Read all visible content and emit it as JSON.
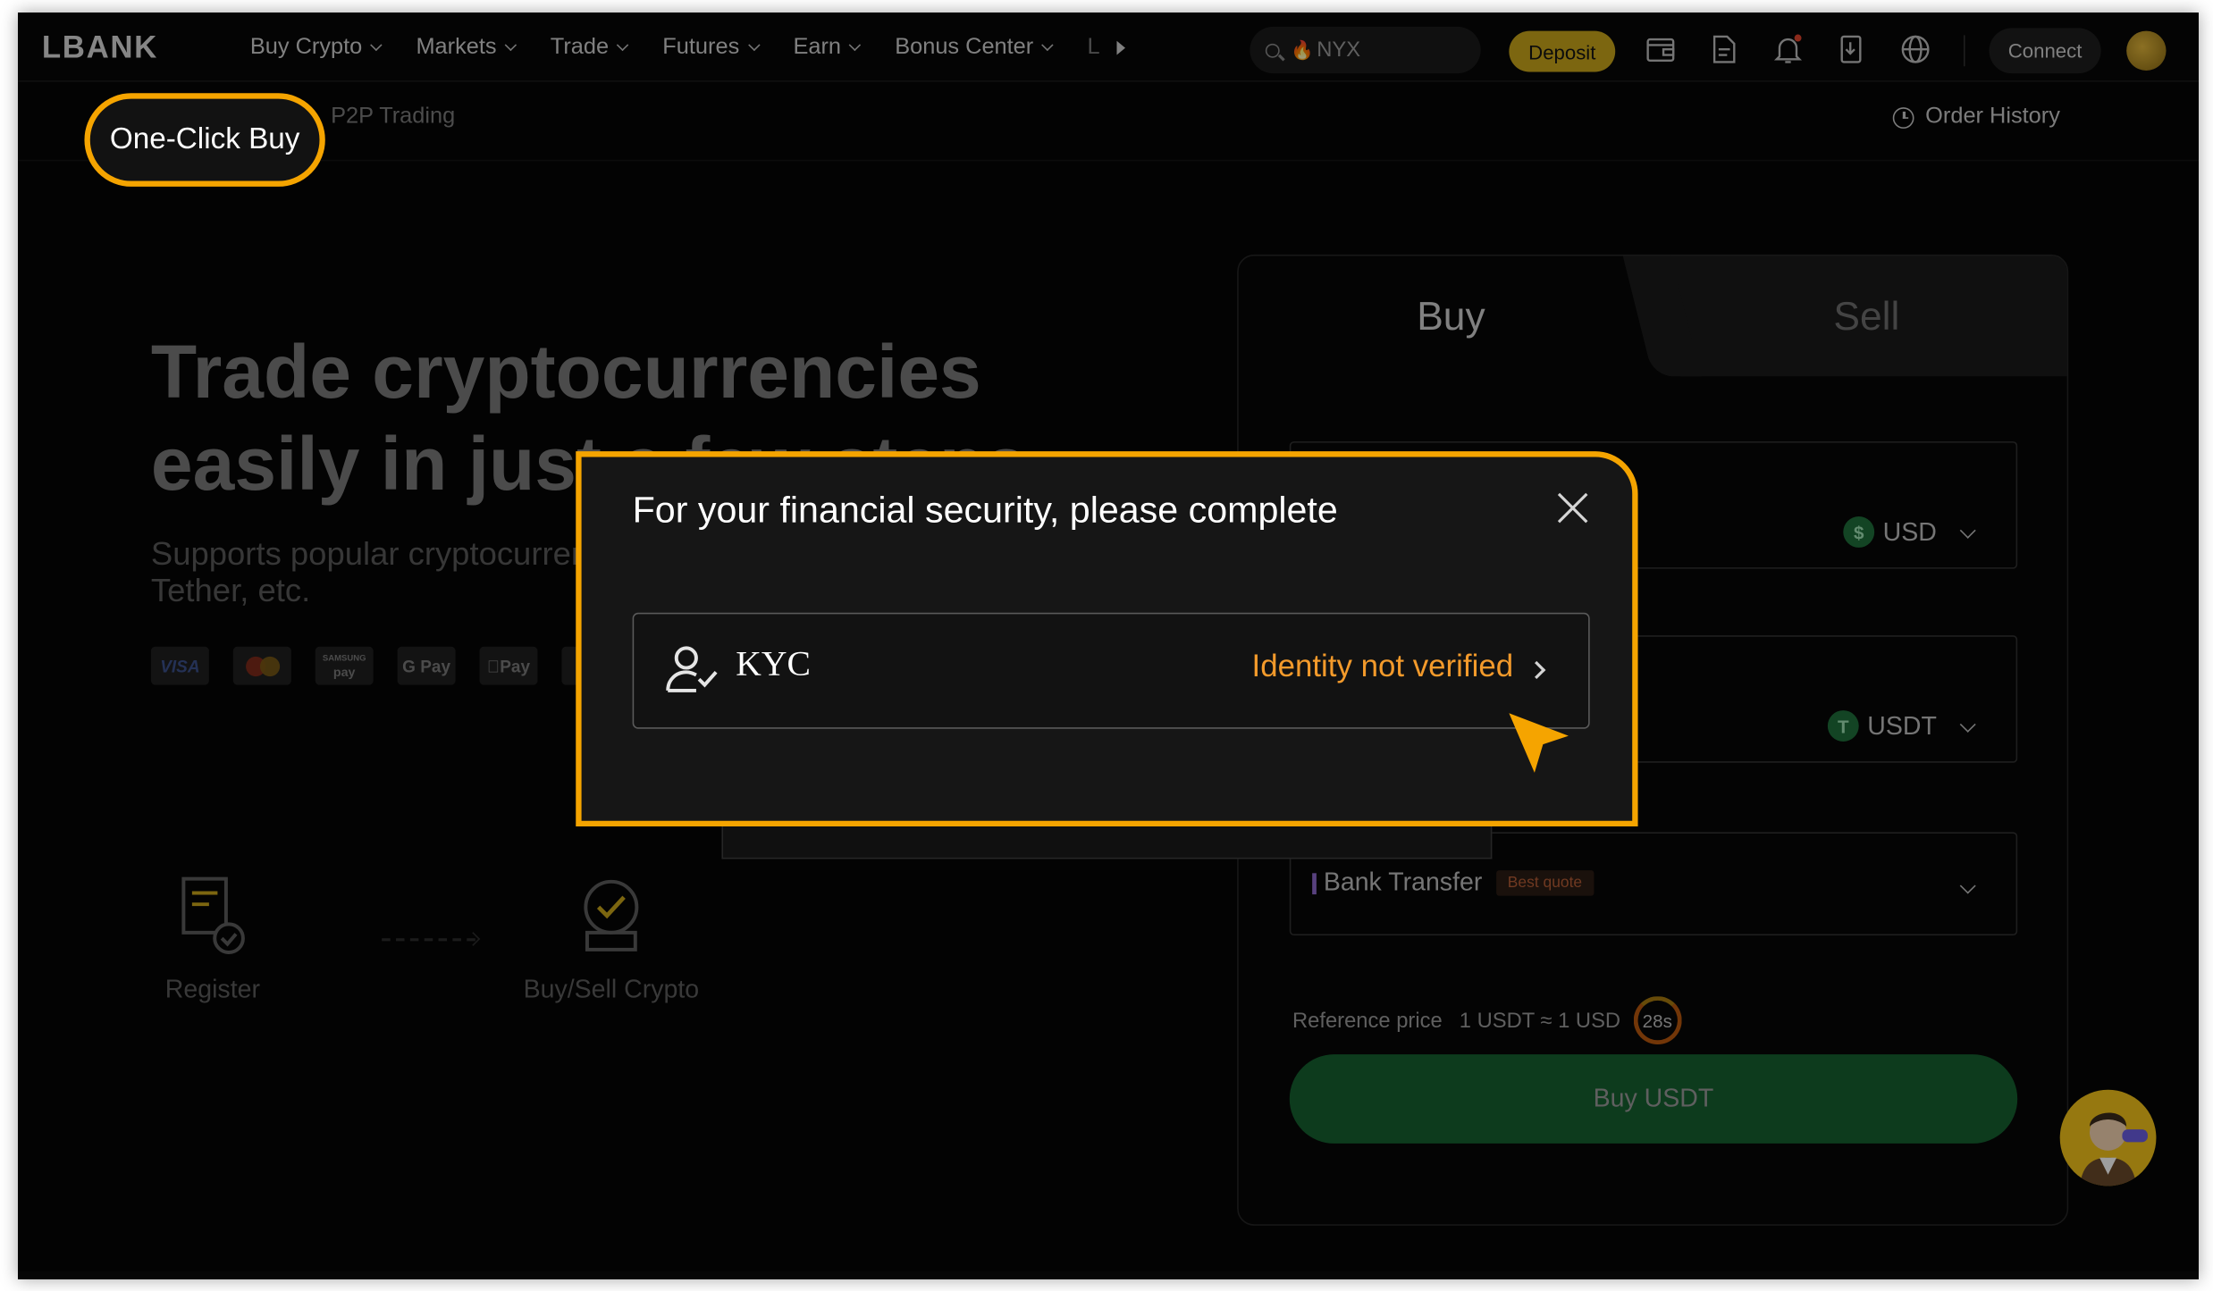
{
  "header": {
    "logo": "LBANK",
    "nav": [
      {
        "label": "Buy Crypto",
        "chevron": true
      },
      {
        "label": "Markets",
        "chevron": true
      },
      {
        "label": "Trade",
        "chevron": true
      },
      {
        "label": "Futures",
        "chevron": true
      },
      {
        "label": "Earn",
        "chevron": true
      },
      {
        "label": "Bonus Center",
        "chevron": true
      }
    ],
    "nav_overflow": "L",
    "search_value": "NYX",
    "deposit_label": "Deposit",
    "connect_label": "Connect",
    "icons": [
      "wallet-icon",
      "document-icon",
      "bell-icon",
      "download-app-icon",
      "globe-icon"
    ],
    "accent": "#c8a51a"
  },
  "subnav": {
    "active_tab": "One-Click Buy",
    "tab_p2p": "P2P Trading",
    "order_history": "Order History"
  },
  "hero": {
    "title_line1": "Trade cryptocurrencies",
    "title_line2": "easily in just a few steps",
    "subtitle_line1": "Supports popular cryptocurrencies such as Bitcoin,",
    "subtitle_line2": "Tether, etc.",
    "payment_methods": [
      "VISA",
      "Mastercard",
      "Samsung Pay",
      "G Pay",
      "Apple Pay"
    ],
    "steps": [
      {
        "label": "Register",
        "icon": "register-icon"
      },
      {
        "label": "Buy/Sell Crypto",
        "icon": "buy-sell-icon"
      }
    ]
  },
  "trade_panel": {
    "tab_buy": "Buy",
    "tab_sell": "Sell",
    "pay_currency": "USD",
    "pay_currency_symbol": "$",
    "receive_currency": "USDT",
    "receive_currency_symbol": "T",
    "payment_method": "Bank Transfer",
    "payment_badge": "Best quote",
    "reference_label": "Reference price",
    "reference_value": "1 USDT ≈ 1 USD",
    "timer": "28s",
    "submit_label": "Buy USDT",
    "submit_color": "#156030"
  },
  "modal": {
    "title": "For your financial security, please complete",
    "item_label": "KYC",
    "item_status": "Identity not verified",
    "status_color": "#f39a2b",
    "highlight_color": "#f5a400"
  }
}
